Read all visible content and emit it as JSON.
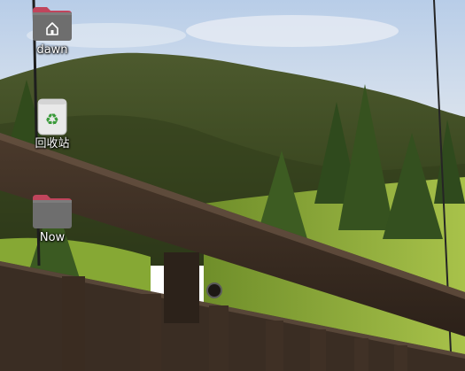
{
  "desktop": {
    "icons": [
      {
        "label": "dawn",
        "kind": "home-folder"
      },
      {
        "label": "回收站",
        "kind": "trash"
      },
      {
        "label": "Now",
        "kind": "folder"
      }
    ]
  },
  "colors": {
    "folder_tab": "#c0455c",
    "folder_body": "#6e6e6e",
    "trash_body": "#e9e9e9",
    "recycle_green": "#3a9a3a"
  }
}
